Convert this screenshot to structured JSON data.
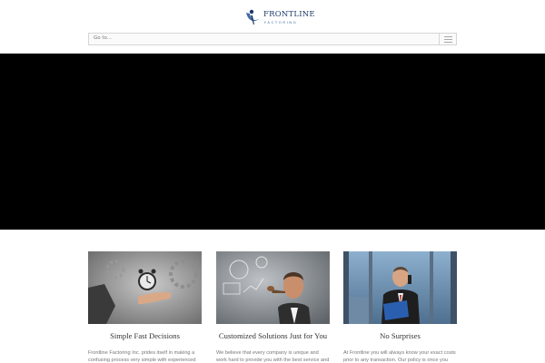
{
  "brand": {
    "name": "FRONTLINE",
    "tagline": "FACTORING"
  },
  "nav": {
    "goto_label": "Go to..."
  },
  "features": [
    {
      "title": "Simple Fast Decisions",
      "text": "Frontline Factoring Inc. prides itself in making a confusing process very simple with experienced"
    },
    {
      "title": "Customized Solutions Just for You",
      "text": "We believe that every company is unique and work hard to provide you with the best service and"
    },
    {
      "title": "No Surprises",
      "text": "At Frontline you will always know your exact costs prior to any transaction. Our policy is once you"
    }
  ],
  "colors": {
    "brand_navy": "#1d3a6b",
    "brand_blue": "#3f6aa5",
    "hero_background": "#000000"
  },
  "icons": {
    "logo": "logo-icon",
    "menu": "hamburger-menu-icon"
  }
}
